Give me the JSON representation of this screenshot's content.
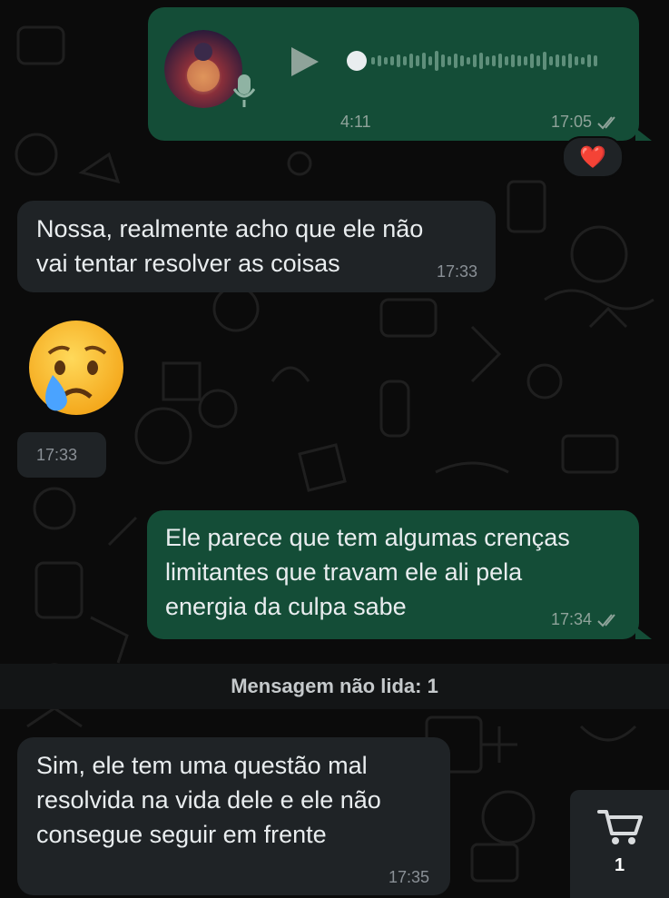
{
  "messages": {
    "voice": {
      "duration": "4:11",
      "time": "17:05",
      "reaction": "❤️"
    },
    "m1": {
      "text": "Nossa, realmente acho que ele não\nvai tentar resolver as coisas",
      "time": "17:33"
    },
    "m2": {
      "emoji": "😢",
      "time": "17:33"
    },
    "m3": {
      "text": "Ele parece que tem algumas crenças\nlimitantes que travam ele ali pela\nenergia da culpa sabe",
      "time": "17:34"
    },
    "m4": {
      "text": "Sim, ele tem uma questão mal\nresolvida na vida dele e ele não\nconsegue seguir em frente",
      "time": "17:35"
    }
  },
  "unread_banner": "Mensagem não lida: 1",
  "cart": {
    "count": "1"
  },
  "colors": {
    "outgoing": "#144d37",
    "incoming": "#1f2326",
    "background": "#0b0b0b"
  }
}
